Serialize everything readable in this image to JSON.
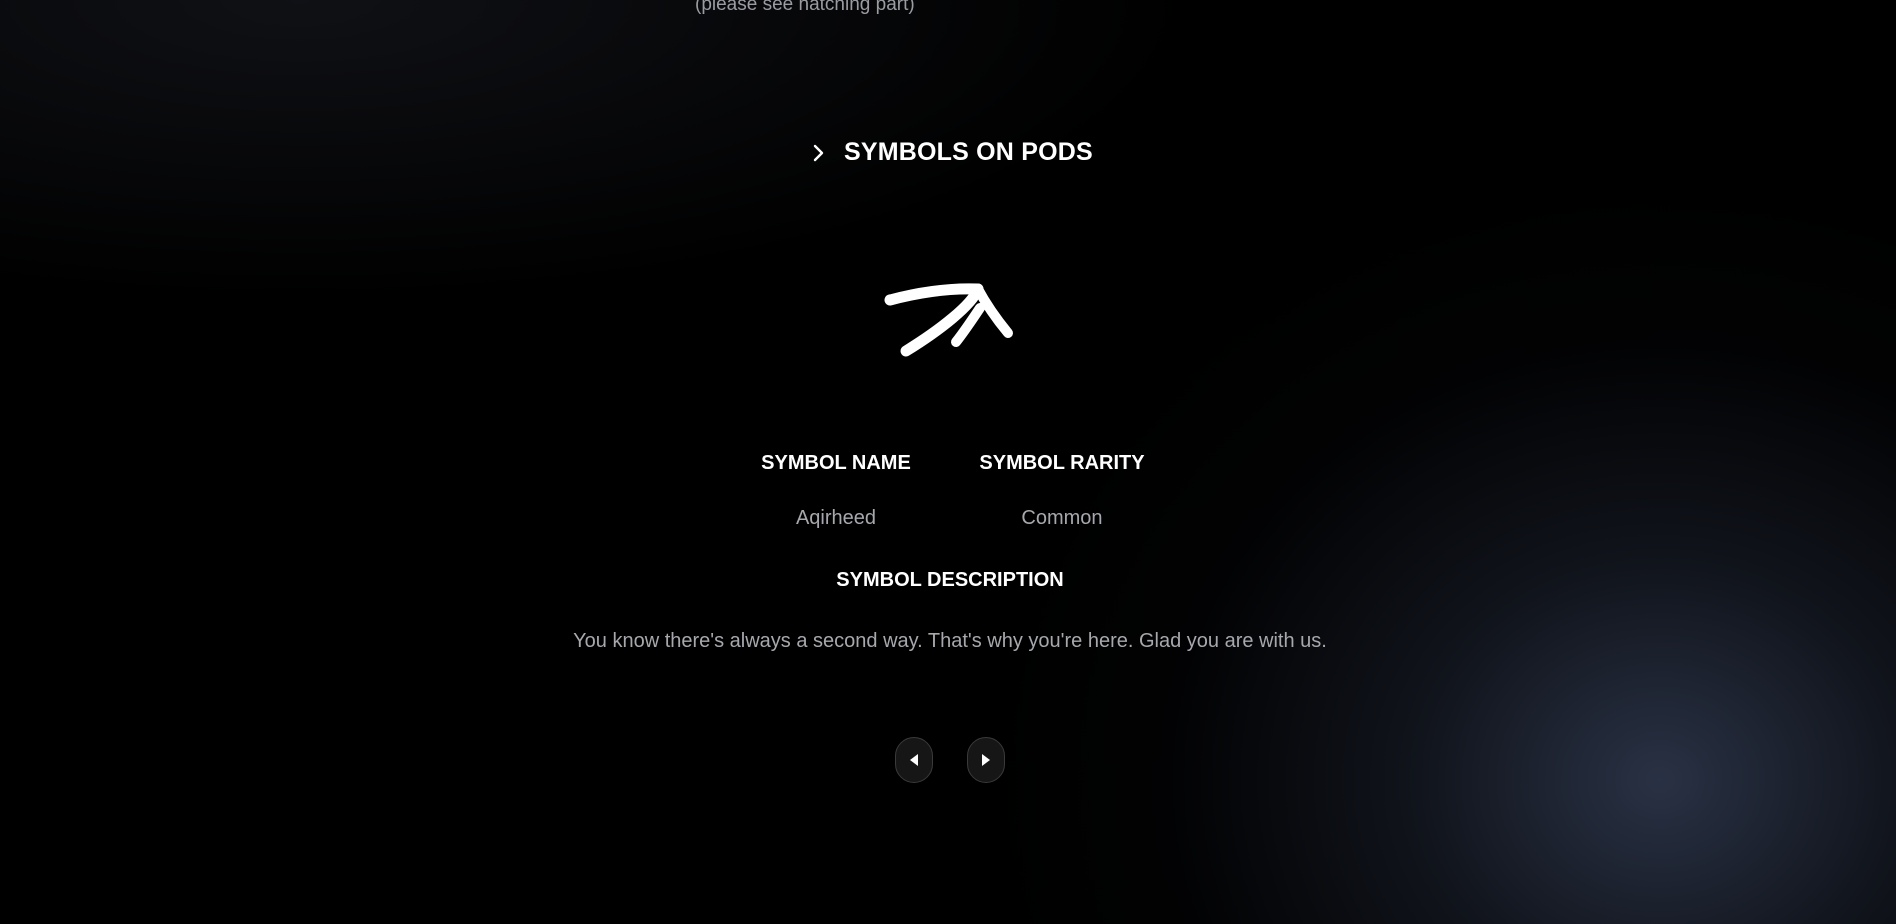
{
  "top_note": "(please see hatching part)",
  "section": {
    "title": "SYMBOLS ON PODS",
    "toggle_icon": "chevron-right-icon"
  },
  "symbol": {
    "glyph_icon": "aqirheed-symbol-icon",
    "name_label": "SYMBOL NAME",
    "name_value": "Aqirheed",
    "rarity_label": "SYMBOL RARITY",
    "rarity_value": "Common",
    "description_label": "SYMBOL DESCRIPTION",
    "description_text": "You know there's always a second way. That's why you're here. Glad you are with us."
  },
  "navigation": {
    "prev_icon": "triangle-left-icon",
    "next_icon": "triangle-right-icon"
  },
  "colors": {
    "background": "#000000",
    "text_primary": "#ffffff",
    "text_secondary": "#a6a8ad",
    "glow": "#2f3a50",
    "button_bg": "#161616"
  }
}
